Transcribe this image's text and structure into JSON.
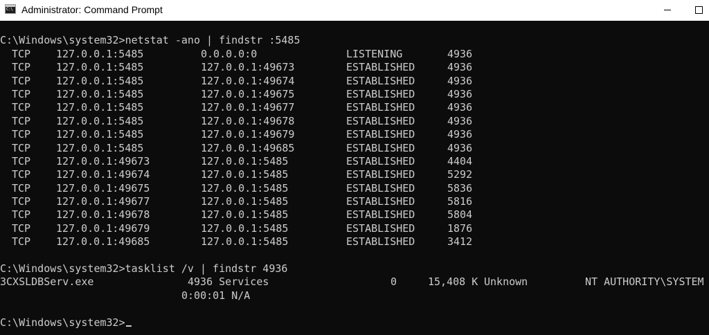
{
  "window": {
    "title": "Administrator: Command Prompt",
    "icon_text": "C:\\",
    "icon": "cmd-icon",
    "minimize_icon": "minimize-icon",
    "maximize_icon": "maximize-icon"
  },
  "colors": {
    "console_background": "#0c0c0c",
    "console_text": "#cccccc",
    "titlebar_background": "#ffffff"
  },
  "console": {
    "command1": "C:\\Windows\\system32>netstat -ano | findstr :5485",
    "netstat_rows": [
      {
        "proto": "TCP",
        "local": "127.0.0.1:5485",
        "foreign": "0.0.0.0:0",
        "state": "LISTENING",
        "pid": "4936"
      },
      {
        "proto": "TCP",
        "local": "127.0.0.1:5485",
        "foreign": "127.0.0.1:49673",
        "state": "ESTABLISHED",
        "pid": "4936"
      },
      {
        "proto": "TCP",
        "local": "127.0.0.1:5485",
        "foreign": "127.0.0.1:49674",
        "state": "ESTABLISHED",
        "pid": "4936"
      },
      {
        "proto": "TCP",
        "local": "127.0.0.1:5485",
        "foreign": "127.0.0.1:49675",
        "state": "ESTABLISHED",
        "pid": "4936"
      },
      {
        "proto": "TCP",
        "local": "127.0.0.1:5485",
        "foreign": "127.0.0.1:49677",
        "state": "ESTABLISHED",
        "pid": "4936"
      },
      {
        "proto": "TCP",
        "local": "127.0.0.1:5485",
        "foreign": "127.0.0.1:49678",
        "state": "ESTABLISHED",
        "pid": "4936"
      },
      {
        "proto": "TCP",
        "local": "127.0.0.1:5485",
        "foreign": "127.0.0.1:49679",
        "state": "ESTABLISHED",
        "pid": "4936"
      },
      {
        "proto": "TCP",
        "local": "127.0.0.1:5485",
        "foreign": "127.0.0.1:49685",
        "state": "ESTABLISHED",
        "pid": "4936"
      },
      {
        "proto": "TCP",
        "local": "127.0.0.1:49673",
        "foreign": "127.0.0.1:5485",
        "state": "ESTABLISHED",
        "pid": "4404"
      },
      {
        "proto": "TCP",
        "local": "127.0.0.1:49674",
        "foreign": "127.0.0.1:5485",
        "state": "ESTABLISHED",
        "pid": "5292"
      },
      {
        "proto": "TCP",
        "local": "127.0.0.1:49675",
        "foreign": "127.0.0.1:5485",
        "state": "ESTABLISHED",
        "pid": "5836"
      },
      {
        "proto": "TCP",
        "local": "127.0.0.1:49677",
        "foreign": "127.0.0.1:5485",
        "state": "ESTABLISHED",
        "pid": "5816"
      },
      {
        "proto": "TCP",
        "local": "127.0.0.1:49678",
        "foreign": "127.0.0.1:5485",
        "state": "ESTABLISHED",
        "pid": "5804"
      },
      {
        "proto": "TCP",
        "local": "127.0.0.1:49679",
        "foreign": "127.0.0.1:5485",
        "state": "ESTABLISHED",
        "pid": "1876"
      },
      {
        "proto": "TCP",
        "local": "127.0.0.1:49685",
        "foreign": "127.0.0.1:5485",
        "state": "ESTABLISHED",
        "pid": "3412"
      }
    ],
    "command2": "C:\\Windows\\system32>tasklist /v | findstr 4936",
    "tasklist_row": {
      "image": "3CXSLDBServ.exe",
      "pid_session": "4936 Services",
      "session_num": "0",
      "mem": "15,408 K",
      "status": "Unknown",
      "user": "NT AUTHORITY\\SYSTEM",
      "cpu_title": "0:00:01 N/A"
    },
    "prompt": "C:\\Windows\\system32>"
  }
}
